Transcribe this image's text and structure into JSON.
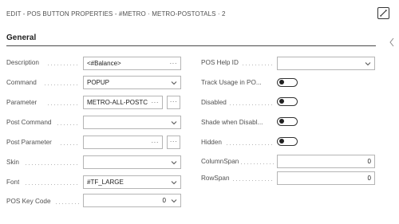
{
  "header": {
    "caption": "EDIT - POS BUTTON PROPERTIES - #METRO · METRO-POSTOTALS · 2",
    "collapse_icon": "collapse-icon"
  },
  "fasttab": {
    "title": "General"
  },
  "left_fields": {
    "description": {
      "label": "Description",
      "value": "<#Balance>"
    },
    "command": {
      "label": "Command",
      "value": "POPUP"
    },
    "parameter": {
      "label": "Parameter",
      "value": "METRO-ALL-POSTC"
    },
    "post_command": {
      "label": "Post Command",
      "value": ""
    },
    "post_parameter": {
      "label": "Post Parameter",
      "value": ""
    },
    "skin": {
      "label": "Skin",
      "value": ""
    },
    "font": {
      "label": "Font",
      "value": "#TF_LARGE"
    },
    "pos_key_code": {
      "label": "POS Key Code",
      "value": "0"
    }
  },
  "right_fields": {
    "pos_help_id": {
      "label": "POS Help ID",
      "value": ""
    },
    "track_usage": {
      "label": "Track Usage in PO...",
      "value": "Off"
    },
    "disabled": {
      "label": "Disabled",
      "value": "Off"
    },
    "shade_when_disabled": {
      "label": "Shade when Disabl...",
      "value": "Off"
    },
    "hidden": {
      "label": "Hidden",
      "value": "Off"
    },
    "column_span": {
      "label": "ColumnSpan",
      "value": "0"
    },
    "row_span": {
      "label": "RowSpan",
      "value": "0"
    }
  },
  "glyphs": {
    "ellipsis": "···"
  },
  "colors": {
    "text": "#212121",
    "label": "#505050",
    "border": "#b5b5b5"
  }
}
